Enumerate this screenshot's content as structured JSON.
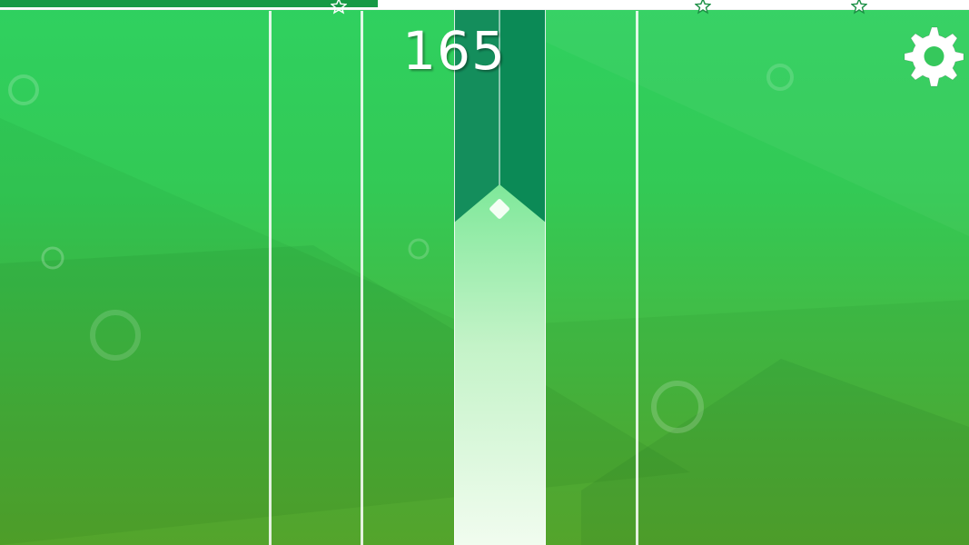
{
  "game": {
    "score": "165",
    "progress_fraction": 0.39,
    "star_markers": [
      {
        "name": "progress-star-1",
        "fraction": 0.35,
        "achieved": false
      },
      {
        "name": "progress-star-2",
        "fraction": 0.725,
        "achieved": true
      },
      {
        "name": "progress-star-3",
        "fraction": 0.887,
        "achieved": true
      }
    ],
    "lane_count": 4,
    "active_lane_index": 2,
    "settings_icon": "gear-icon",
    "colors": {
      "background_top": "#2fd160",
      "background_bottom": "#5aa92d",
      "progress_fill": "#179a45",
      "tile_dark": "#0b8a56",
      "tile_glow": "#e9fbe9",
      "track": "#ffffff"
    }
  }
}
